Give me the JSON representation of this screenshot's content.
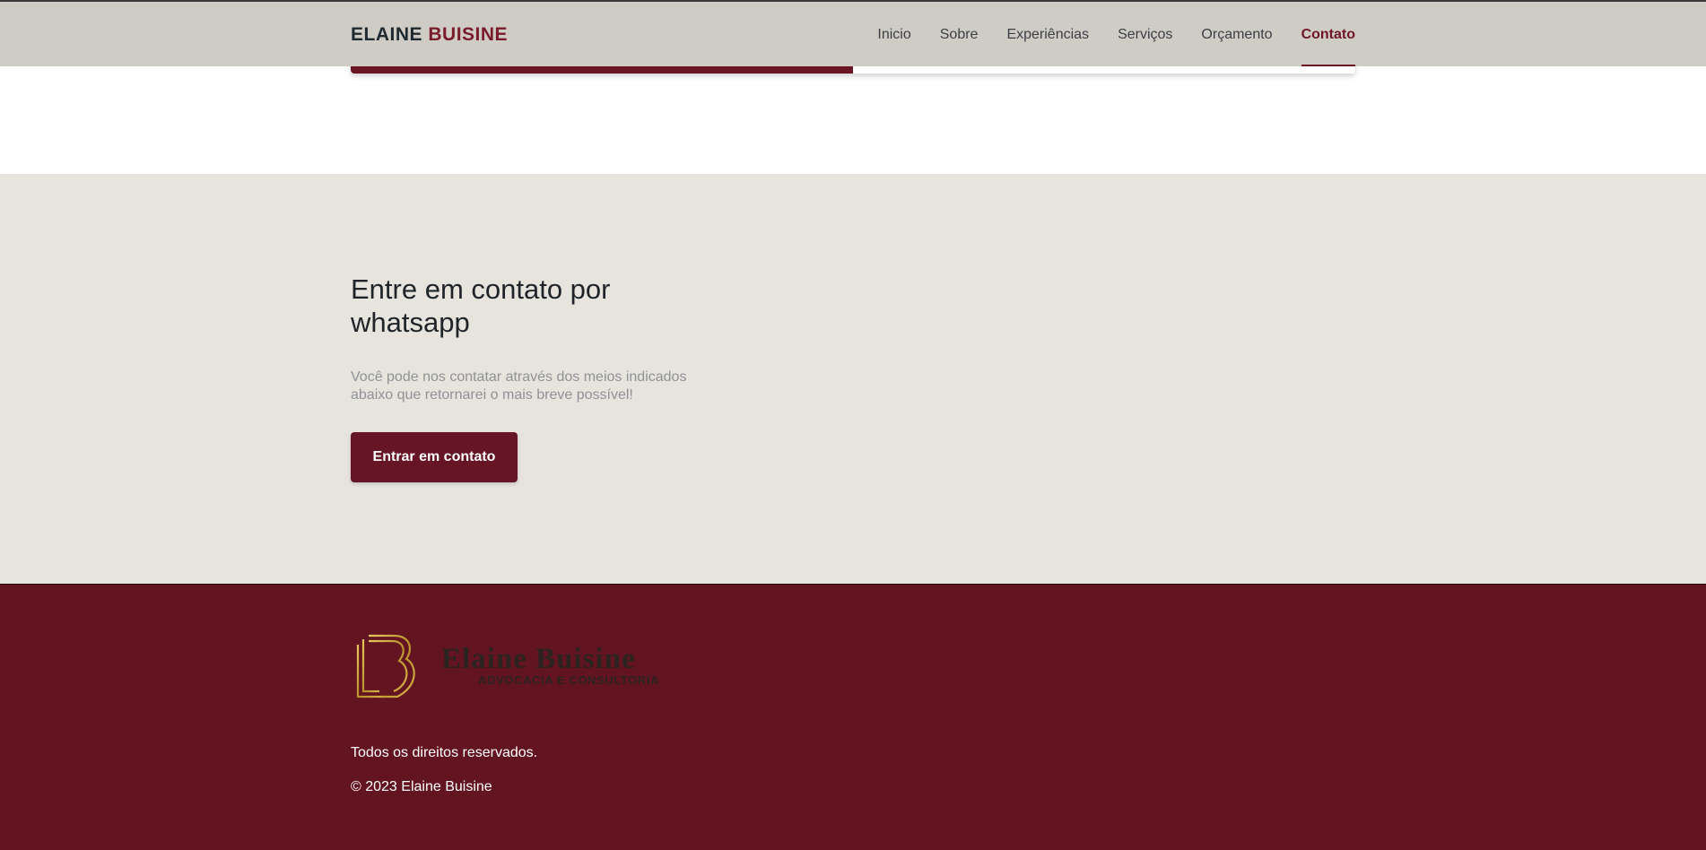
{
  "header": {
    "brand_first": "ELAINE",
    "brand_second": "BUISINE",
    "nav": [
      {
        "label": "Inicio",
        "active": false
      },
      {
        "label": "Sobre",
        "active": false
      },
      {
        "label": "Experiências",
        "active": false
      },
      {
        "label": "Serviços",
        "active": false
      },
      {
        "label": "Orçamento",
        "active": false
      },
      {
        "label": "Contato",
        "active": true
      }
    ]
  },
  "progress": {
    "fraction": 0.5
  },
  "contact": {
    "title": "Entre em contato por whatsapp",
    "text": "Você pode nos contatar através dos meios indicados abaixo que retornarei o mais breve possível!",
    "button_label": "Entrar em contato"
  },
  "footer": {
    "logo_name": "Elaine Buisine",
    "logo_tagline": "ADVOCACIA E CONSULTORIA",
    "rights": "Todos os direitos reservados.",
    "copyright": "© 2023 Elaine Buisine"
  },
  "colors": {
    "nav_bg": "#cfccc5",
    "accent": "#6a1424",
    "section_bg": "#e7e3dd",
    "footer_bg": "#631421",
    "gold": "#c9a23a"
  },
  "icons": {
    "logo_monogram": "eb-monogram-icon"
  }
}
